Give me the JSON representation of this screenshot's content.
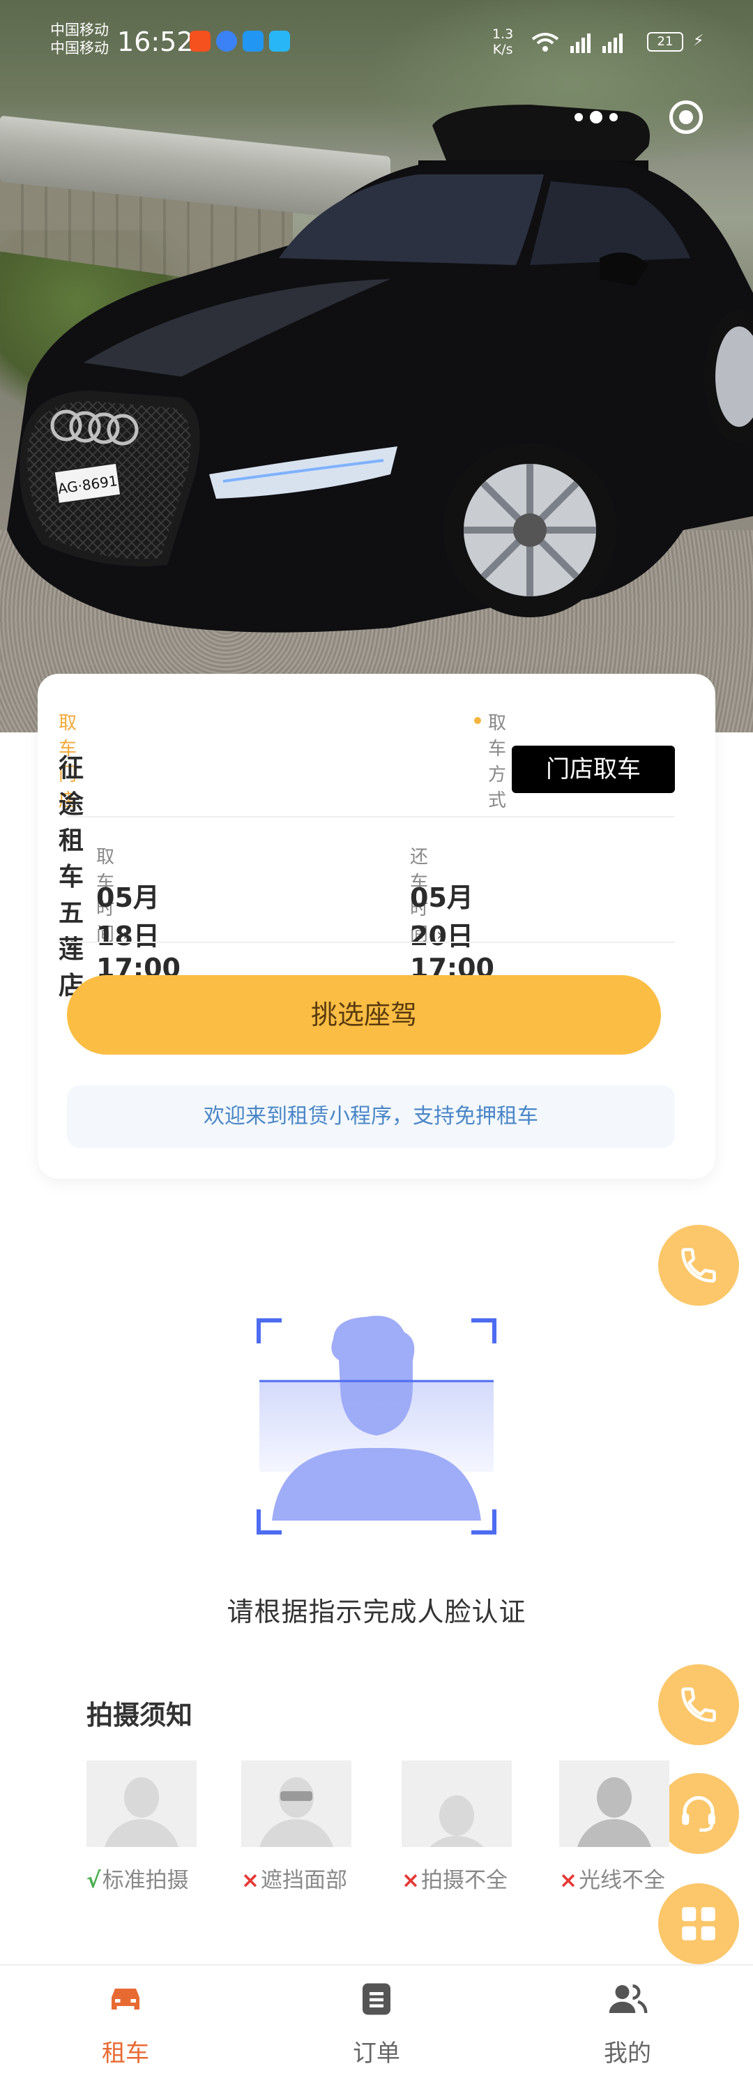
{
  "status_bar": {
    "carrier_1": "中国移动",
    "carrier_2": "中国移动",
    "time": "16:52",
    "net_speed_value": "1.3",
    "net_speed_unit": "K/s",
    "battery": "21"
  },
  "capsule": {
    "more_icon": "more-dots-icon",
    "close_icon": "target-close-icon"
  },
  "booking": {
    "pickup_store_label": "取车门店",
    "pickup_store_name": "征途租车五莲店",
    "pickup_method_label": "取车方式",
    "pickup_method_value": "门店取车",
    "pickup_time_label": "取车时间",
    "pickup_time_value": "05月18日 17:00",
    "return_time_label": "还车时间",
    "return_time_value": "05月20日 17:00",
    "select_car_button": "挑选座驾",
    "welcome_text": "欢迎来到租赁小程序，支持免押租车"
  },
  "face_verification": {
    "caption": "请根据指示完成人脸认证",
    "notes_title": "拍摄须知",
    "samples": [
      {
        "mark": "√",
        "label": "标准拍摄"
      },
      {
        "mark": "×",
        "label": "遮挡面部"
      },
      {
        "mark": "×",
        "label": "拍摄不全"
      },
      {
        "mark": "×",
        "label": "光线不全"
      }
    ]
  },
  "floating_buttons": [
    "phone-icon",
    "phone-icon",
    "customer-service-icon",
    "grid-menu-icon"
  ],
  "colors": {
    "accent": "#fbbd43",
    "fab": "#fbc76a",
    "active_tab": "#e86a33",
    "link": "#4a86c8",
    "face": "#9aa8f7"
  },
  "tabbar": {
    "items": [
      {
        "label": "租车",
        "icon": "car-icon",
        "active": true
      },
      {
        "label": "订单",
        "icon": "order-list-icon",
        "active": false
      },
      {
        "label": "我的",
        "icon": "user-profile-icon",
        "active": false
      }
    ]
  }
}
